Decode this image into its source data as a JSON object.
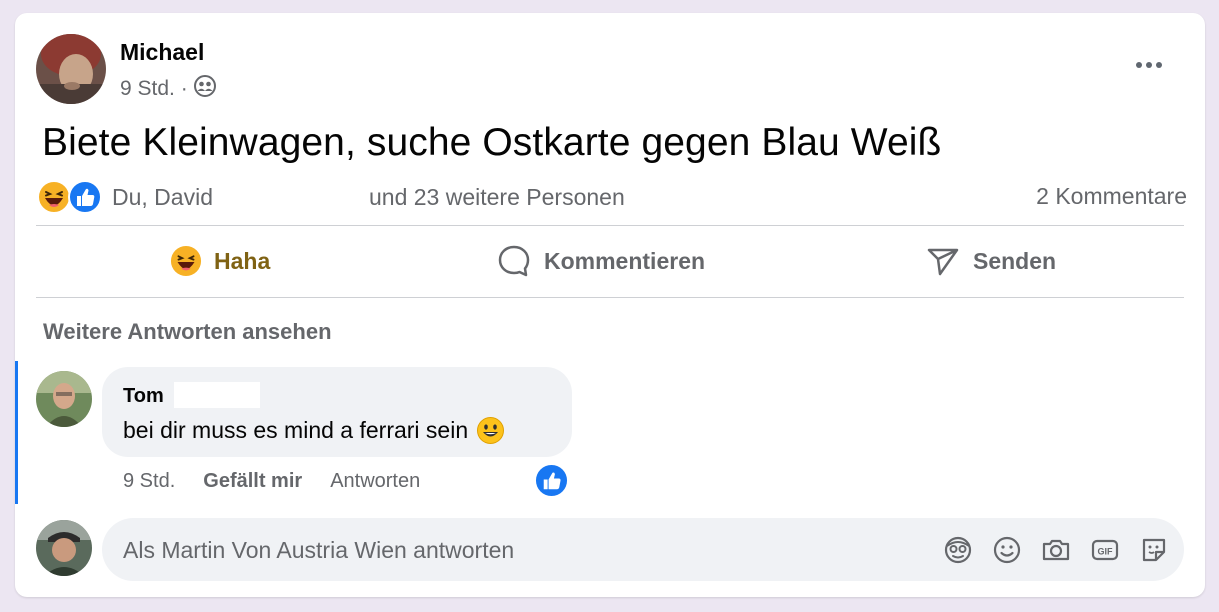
{
  "post": {
    "author": "Michael",
    "time": "9 Std. ·",
    "text": "Biete Kleinwagen, suche Ostkarte gegen Blau Weiß",
    "reactions": {
      "names": "Du, David",
      "others": "und 23 weitere Personen",
      "icons": [
        "haha-emoji-icon",
        "like-icon"
      ]
    },
    "comments_count": "2 Kommentare"
  },
  "actions": {
    "haha_label": "Haha",
    "comment_label": "Kommentieren",
    "send_label": "Senden"
  },
  "comments": {
    "more_replies": "Weitere Antworten ansehen",
    "items": [
      {
        "author": "Tom",
        "text": "bei dir muss es mind a ferrari sein",
        "time": "9 Std.",
        "like_label": "Gefällt mir",
        "reply_label": "Antworten"
      }
    ]
  },
  "reply": {
    "placeholder": "Als Martin Von Austria Wien antworten",
    "tools": [
      "avatar-sticker-icon",
      "emoji-icon",
      "camera-icon",
      "gif-icon",
      "sticker-icon"
    ]
  },
  "colors": {
    "accent": "#1877f2",
    "haha_text": "#7f6214",
    "secondary_text": "#65676b",
    "bubble_bg": "#f0f2f5"
  }
}
